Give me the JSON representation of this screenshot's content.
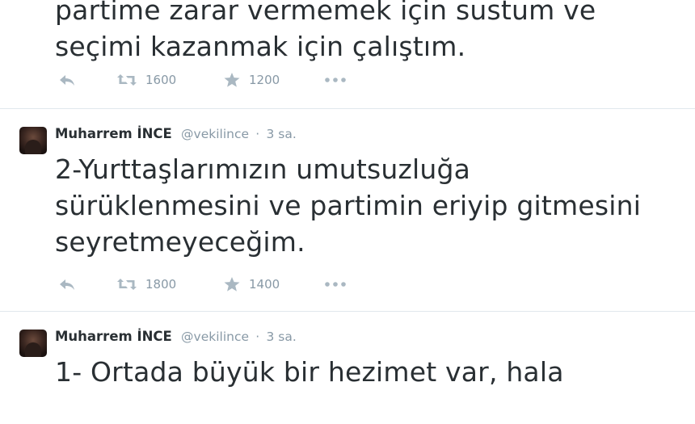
{
  "tweets": [
    {
      "lines": [
        "partime zarar vermemek için sustum ve",
        "seçimi kazanmak için çalıştım."
      ],
      "retweets": "1600",
      "favorites": "1200"
    },
    {
      "fullname": "Muharrem İNCE",
      "username": "@vekilince",
      "separator": "·",
      "time": "3 sa.",
      "lines": [
        "2-Yurttaşlarımızın umutsuzluğa",
        "sürüklenmesini ve partimin eriyip gitmesini",
        "seyretmeyeceğim."
      ],
      "retweets": "1800",
      "favorites": "1400"
    },
    {
      "fullname": "Muharrem İNCE",
      "username": "@vekilince",
      "separator": "·",
      "time": "3 sa.",
      "lines": [
        "1- Ortada büyük bir hezimet var, hala"
      ]
    }
  ],
  "icons": {
    "reply": "reply-icon",
    "retweet": "retweet-icon",
    "favorite": "star-icon",
    "more": "more-icon"
  },
  "colors": {
    "text": "#292f33",
    "muted": "#8899a6",
    "icon": "#aab8c2",
    "divider": "#e1e8ed"
  }
}
